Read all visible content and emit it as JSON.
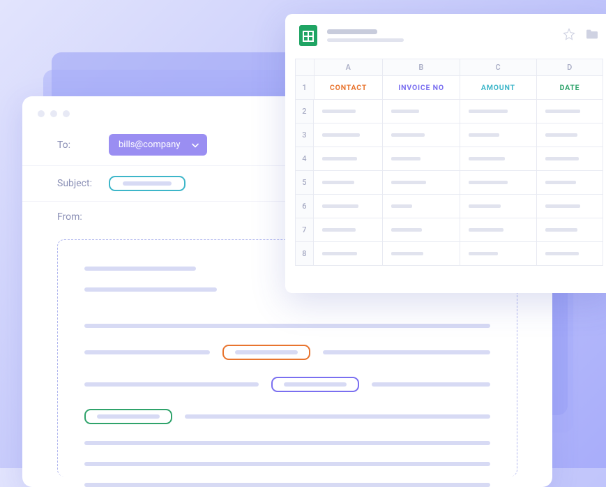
{
  "email": {
    "to_label": "To:",
    "to_value": "bills@company",
    "subject_label": "Subject:",
    "from_label": "From:"
  },
  "sheet": {
    "columns": {
      "a": "A",
      "b": "B",
      "c": "C",
      "d": "D"
    },
    "rows": [
      "1",
      "2",
      "3",
      "4",
      "5",
      "6",
      "7",
      "8"
    ],
    "headers": {
      "contact": "CONTACT",
      "invoice_no": "INVOICE NO",
      "amount": "AMOUNT",
      "date": "DATE"
    }
  }
}
